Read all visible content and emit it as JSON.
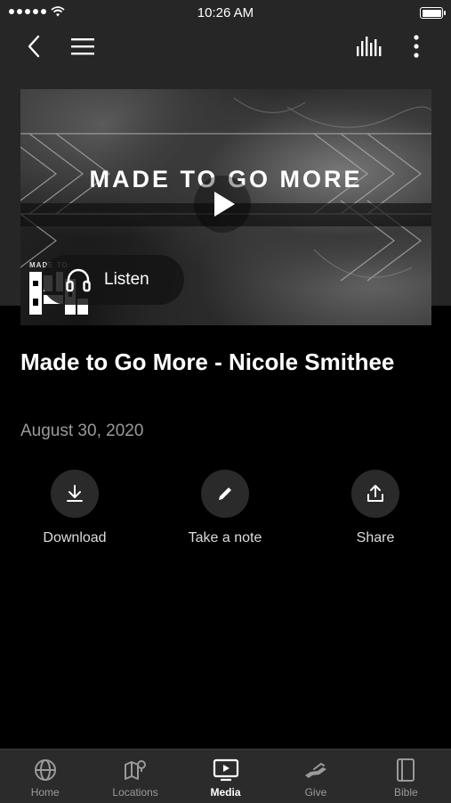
{
  "status_bar": {
    "time": "10:26 AM"
  },
  "hero": {
    "title": "MADE TO GO MORE",
    "listen_label": "Listen",
    "logo_text": "MADE TO"
  },
  "sermon": {
    "title": "Made to Go More - Nicole Smithee",
    "date": "August 30, 2020"
  },
  "actions": [
    {
      "label": "Download",
      "icon": "download-icon"
    },
    {
      "label": "Take a note",
      "icon": "pencil-icon"
    },
    {
      "label": "Share",
      "icon": "share-icon"
    }
  ],
  "tabs": [
    {
      "label": "Home",
      "icon": "globe-icon"
    },
    {
      "label": "Locations",
      "icon": "map-pin-icon"
    },
    {
      "label": "Media",
      "icon": "tv-play-icon"
    },
    {
      "label": "Give",
      "icon": "hand-give-icon"
    },
    {
      "label": "Bible",
      "icon": "book-icon"
    }
  ],
  "active_tab": "Media",
  "colors": {
    "background": "#000000",
    "header_background": "#262626",
    "tabbar_background": "#2b2b2b",
    "muted_text": "#9a9a9a"
  }
}
